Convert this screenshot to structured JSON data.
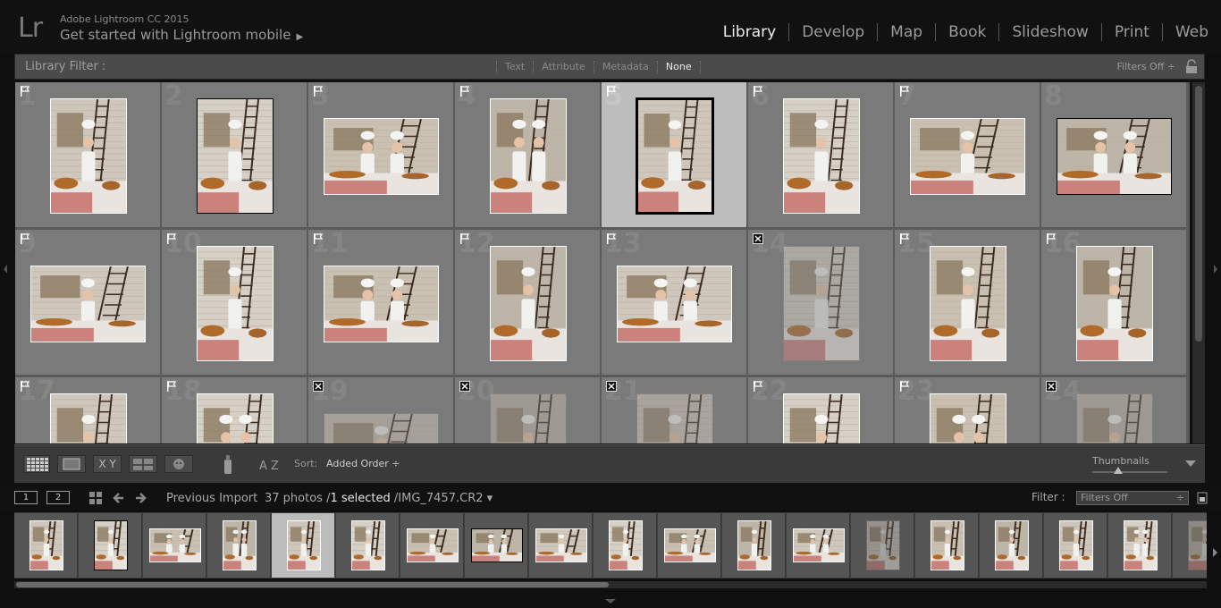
{
  "header": {
    "product": "Adobe Lightroom CC 2015",
    "get_started": "Get started with Lightroom mobile",
    "logo": "Lr",
    "modules": [
      {
        "label": "Library",
        "active": true
      },
      {
        "label": "Develop",
        "active": false
      },
      {
        "label": "Map",
        "active": false
      },
      {
        "label": "Book",
        "active": false
      },
      {
        "label": "Slideshow",
        "active": false
      },
      {
        "label": "Print",
        "active": false
      },
      {
        "label": "Web",
        "active": false
      }
    ]
  },
  "filter_bar": {
    "label": "Library Filter :",
    "tabs": [
      {
        "label": "Text",
        "active": false
      },
      {
        "label": "Attribute",
        "active": false
      },
      {
        "label": "Metadata",
        "active": false
      },
      {
        "label": "None",
        "active": true
      }
    ],
    "preset": "Filters Off ÷",
    "lock_icon": "lock-icon"
  },
  "grid": {
    "cells": [
      {
        "num": "1",
        "flag": "flag",
        "orient": "p",
        "scene": 0,
        "selected": false
      },
      {
        "num": "2",
        "flag": "",
        "orient": "p",
        "scene": 1,
        "selected": false,
        "dark": true
      },
      {
        "num": "3",
        "flag": "flag",
        "orient": "l",
        "scene": 2,
        "selected": false
      },
      {
        "num": "4",
        "flag": "flag",
        "orient": "p",
        "scene": 3,
        "selected": false
      },
      {
        "num": "5",
        "flag": "flag",
        "orient": "p",
        "scene": 4,
        "selected": true
      },
      {
        "num": "6",
        "flag": "flag",
        "orient": "p",
        "scene": 5,
        "selected": false
      },
      {
        "num": "7",
        "flag": "flag",
        "orient": "l",
        "scene": 6,
        "selected": false
      },
      {
        "num": "8",
        "flag": "",
        "orient": "l",
        "scene": 7,
        "selected": false,
        "dark": true
      },
      {
        "num": "9",
        "flag": "flag",
        "orient": "l",
        "scene": 8,
        "selected": false
      },
      {
        "num": "10",
        "flag": "flag",
        "orient": "p",
        "scene": 9,
        "selected": false
      },
      {
        "num": "11",
        "flag": "flag",
        "orient": "l",
        "scene": 10,
        "selected": false
      },
      {
        "num": "12",
        "flag": "flag",
        "orient": "p",
        "scene": 11,
        "selected": false
      },
      {
        "num": "13",
        "flag": "flag",
        "orient": "l",
        "scene": 12,
        "selected": false
      },
      {
        "num": "14",
        "flag": "reject",
        "orient": "p",
        "scene": 13,
        "selected": false
      },
      {
        "num": "15",
        "flag": "flag",
        "orient": "p",
        "scene": 14,
        "selected": false
      },
      {
        "num": "16",
        "flag": "flag",
        "orient": "p",
        "scene": 15,
        "selected": false
      },
      {
        "num": "17",
        "flag": "flag",
        "orient": "p",
        "scene": 16,
        "selected": false
      },
      {
        "num": "18",
        "flag": "flag",
        "orient": "p",
        "scene": 17,
        "selected": false
      },
      {
        "num": "19",
        "flag": "reject",
        "orient": "l",
        "scene": 18,
        "selected": false
      },
      {
        "num": "20",
        "flag": "reject",
        "orient": "p",
        "scene": 19,
        "selected": false
      },
      {
        "num": "21",
        "flag": "reject",
        "orient": "p",
        "scene": 20,
        "selected": false
      },
      {
        "num": "22",
        "flag": "flag",
        "orient": "p",
        "scene": 21,
        "selected": false
      },
      {
        "num": "23",
        "flag": "flag",
        "orient": "p",
        "scene": 22,
        "selected": false
      },
      {
        "num": "24",
        "flag": "reject",
        "orient": "p",
        "scene": 23,
        "selected": false
      }
    ]
  },
  "toolbar": {
    "sort_label": "Sort:",
    "sort_value": "Added Order ÷",
    "thumbnails_label": "Thumbnails",
    "thumbnail_size": 0.35,
    "icons": [
      "grid-view-icon",
      "loupe-view-icon",
      "compare-view-icon",
      "survey-view-icon",
      "people-view-icon",
      "painter-icon",
      "sort-direction-icon"
    ],
    "compare_label": "X Y",
    "sort_glyph": "A Z"
  },
  "filmstrip_bar": {
    "screen1": "1",
    "screen2": "2",
    "source": "Previous Import",
    "count_prefix": "37 photos /",
    "count_selected": "1 selected",
    "count_suffix": "/IMG_7457.CR2 ▾",
    "filter_label": "Filter :",
    "filter_value": "Filters Off"
  },
  "filmstrip": {
    "items": [
      {
        "orient": "p",
        "scene": 0
      },
      {
        "orient": "p",
        "scene": 1,
        "dark": true
      },
      {
        "orient": "l",
        "scene": 2
      },
      {
        "orient": "p",
        "scene": 3
      },
      {
        "orient": "p",
        "scene": 4,
        "selected": true
      },
      {
        "orient": "p",
        "scene": 5
      },
      {
        "orient": "l",
        "scene": 6
      },
      {
        "orient": "l",
        "scene": 7,
        "dark": true
      },
      {
        "orient": "l",
        "scene": 8
      },
      {
        "orient": "p",
        "scene": 9
      },
      {
        "orient": "l",
        "scene": 10
      },
      {
        "orient": "p",
        "scene": 11
      },
      {
        "orient": "l",
        "scene": 12
      },
      {
        "orient": "p",
        "scene": 13,
        "rej": true
      },
      {
        "orient": "p",
        "scene": 14
      },
      {
        "orient": "p",
        "scene": 15
      },
      {
        "orient": "p",
        "scene": 16
      },
      {
        "orient": "p",
        "scene": 17
      },
      {
        "orient": "p",
        "scene": 18,
        "rej": true
      }
    ]
  }
}
